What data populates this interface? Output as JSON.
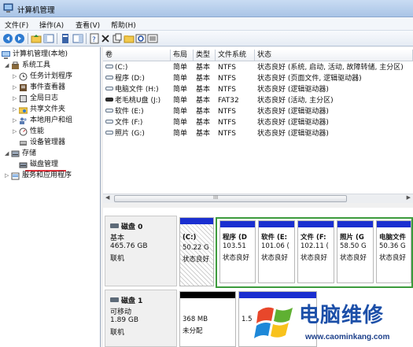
{
  "window": {
    "title": "计算机管理"
  },
  "menu": [
    "文件(F)",
    "操作(A)",
    "查看(V)",
    "帮助(H)"
  ],
  "toolbar": [
    "back-icon",
    "forward-icon",
    "up-icon",
    "show-tree-icon",
    "properties-icon",
    "help-icon",
    "connect-icon",
    "delete-icon",
    "copy-icon",
    "open-icon",
    "search-icon",
    "view-icon"
  ],
  "tree": {
    "root": "计算机管理(本地)",
    "system_tools": "系统工具",
    "task_scheduler": "任务计划程序",
    "event_viewer": "事件查看器",
    "shared_folders_log": "全局日志",
    "shared_folders": "共享文件夹",
    "local_users": "本地用户和组",
    "performance": "性能",
    "device_manager": "设备管理器",
    "storage": "存储",
    "disk_management": "磁盘管理",
    "services": "服务和应用程序"
  },
  "columns": [
    "卷",
    "布局",
    "类型",
    "文件系统",
    "状态"
  ],
  "volumes": [
    {
      "name": "(C:)",
      "layout": "简单",
      "type": "基本",
      "fs": "NTFS",
      "status": "状态良好 (系统, 启动, 活动, 故障转储, 主分区)"
    },
    {
      "name": "程序 (D:)",
      "layout": "简单",
      "type": "基本",
      "fs": "NTFS",
      "status": "状态良好 (页面文件, 逻辑驱动器)"
    },
    {
      "name": "电脑文件 (H:)",
      "layout": "简单",
      "type": "基本",
      "fs": "NTFS",
      "status": "状态良好 (逻辑驱动器)"
    },
    {
      "name": "老毛桃U盘 (J:)",
      "layout": "简单",
      "type": "基本",
      "fs": "FAT32",
      "status": "状态良好 (活动, 主分区)"
    },
    {
      "name": "软件 (E:)",
      "layout": "简单",
      "type": "基本",
      "fs": "NTFS",
      "status": "状态良好 (逻辑驱动器)"
    },
    {
      "name": "文件 (F:)",
      "layout": "简单",
      "type": "基本",
      "fs": "NTFS",
      "status": "状态良好 (逻辑驱动器)"
    },
    {
      "name": "照片 (G:)",
      "layout": "简单",
      "type": "基本",
      "fs": "NTFS",
      "status": "状态良好 (逻辑驱动器)"
    }
  ],
  "scroll_grip": "III",
  "disk0": {
    "name": "磁盘 0",
    "type": "基本",
    "size": "465.76 GB",
    "state": "联机",
    "partitions": [
      {
        "label": "(C:)",
        "size": "50.22 G",
        "status": "状态良好"
      },
      {
        "label": "程序 (D",
        "size": "103.51",
        "status": "状态良好"
      },
      {
        "label": "软件 (E:",
        "size": "101.06 (",
        "status": "状态良好"
      },
      {
        "label": "文件 (F:",
        "size": "102.11 (",
        "status": "状态良好"
      },
      {
        "label": "照片 (G",
        "size": "58.50 G",
        "status": "状态良好"
      },
      {
        "label": "电脑文件",
        "size": "50.36 G",
        "status": "状态良好"
      }
    ]
  },
  "disk1": {
    "name": "磁盘 1",
    "type": "可移动",
    "size": "1.89 GB",
    "state": "联机",
    "unallocated": {
      "size": "368 MB",
      "label": "未分配"
    },
    "partial": "1.5"
  },
  "watermark": {
    "text": "电脑维修",
    "url": "www.caominkang.com"
  },
  "colors": {
    "primary_bar": "#1a2fd0",
    "logical_bar": "#1a2fd0",
    "unallocated_bar": "#000000",
    "usb_bar": "#1a2fd0",
    "selected_underline": "#e0303a"
  }
}
